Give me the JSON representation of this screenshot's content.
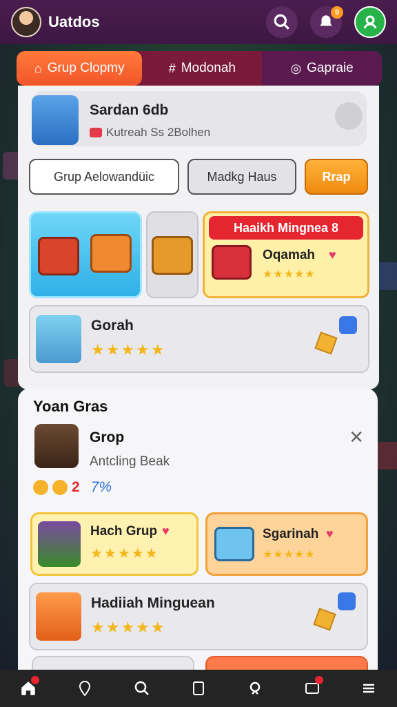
{
  "header": {
    "title": "Uatdos",
    "notification_badge": "9"
  },
  "tabs": [
    {
      "label": "Grup Clopmy"
    },
    {
      "label": "Modonah"
    },
    {
      "label": "Gapraie"
    }
  ],
  "profile": {
    "name": "Sardan 6db",
    "subtitle": "Kutreah Ss 2Bolhen"
  },
  "actions": {
    "primary": "Grup Aelowandüic",
    "secondary": "Madkg Haus",
    "cta": "Rrap"
  },
  "featured": {
    "banner": "Haaikh Mingnea 8",
    "title": "Oqamah",
    "rating": "★★★★★"
  },
  "card_gorah": {
    "title": "Gorah",
    "rating": "★★★★★"
  },
  "sheet": {
    "title": "Yoan Gras",
    "user_name": "Grop",
    "user_sub": "Antcling Beak",
    "stat_count": "2",
    "stat_percent": "7%",
    "cards": [
      {
        "title": "Hach Grup",
        "rating": "★★★★★"
      },
      {
        "title": "Sgarinah",
        "rating": "★★★★★"
      }
    ],
    "wide_card": {
      "title": "Hadiiah Minguean",
      "rating": "★★★★★"
    }
  },
  "colors": {
    "topbar": "#4a1d4f",
    "tab_active": "#f2552a",
    "accent_orange": "#f08a10",
    "star": "#f3b61b"
  }
}
